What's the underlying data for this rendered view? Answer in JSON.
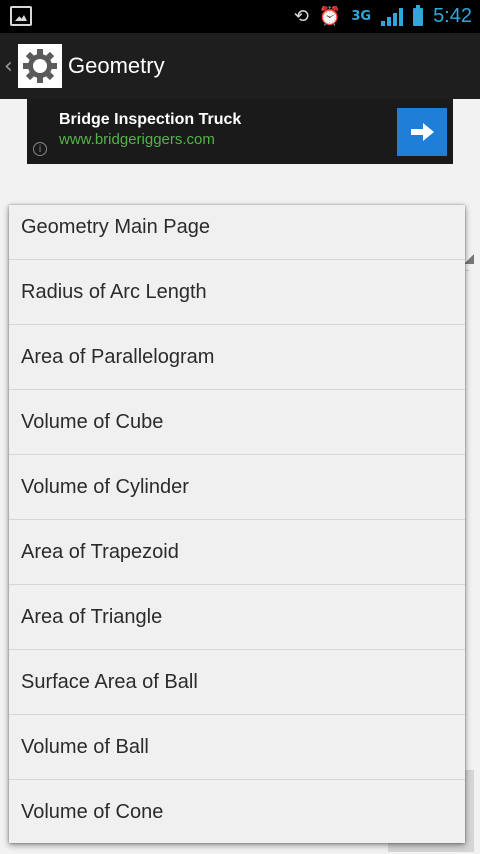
{
  "status_bar": {
    "time": "5:42",
    "network": "3G",
    "icons": [
      "image-icon",
      "rotate-icon",
      "alarm-icon",
      "3g-icon",
      "signal-icon",
      "battery-icon"
    ]
  },
  "action_bar": {
    "title": "Geometry",
    "up_icon": "chevron-left-icon",
    "app_icon": "gear-icon"
  },
  "ad": {
    "title": "Bridge Inspection Truck",
    "url": "www.bridgeriggers.com",
    "info_icon": "info-icon",
    "button_icon": "arrow-right-icon",
    "url_color": "#52b548",
    "button_color": "#1f7fd8"
  },
  "dropdown": {
    "items": [
      "Geometry Main Page",
      "Radius of Arc Length",
      "Area of Parallelogram",
      "Volume of Cube",
      "Volume of Cylinder",
      "Area of Trapezoid",
      "Area of Triangle",
      "Surface Area of Ball",
      "Volume of Ball",
      "Volume of Cone"
    ]
  },
  "colors": {
    "status_accent": "#2fa7d8",
    "action_bar_bg": "#1e1e1e",
    "page_bg": "#f2f2f2"
  }
}
